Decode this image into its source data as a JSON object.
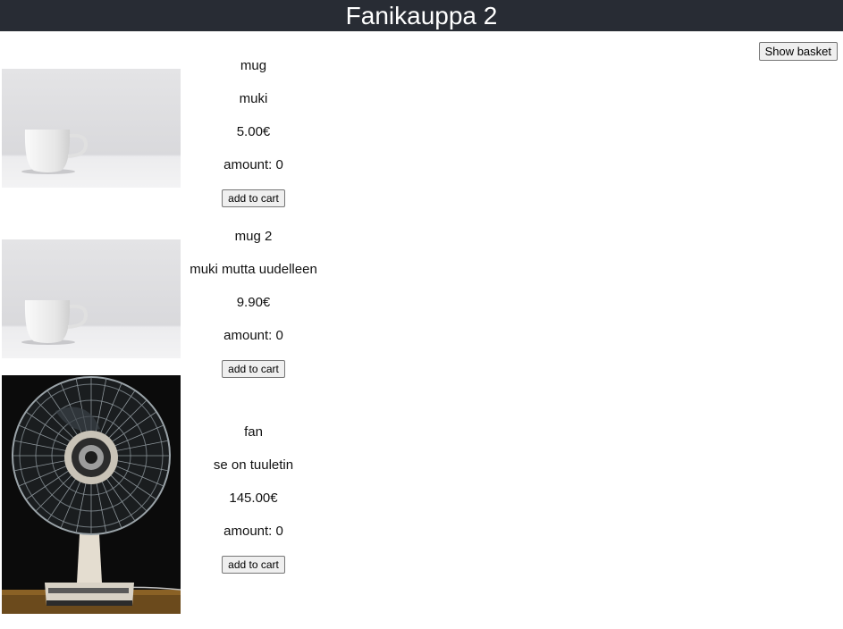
{
  "header": {
    "title": "Fanikauppa 2"
  },
  "basket_button": "Show basket",
  "products": [
    {
      "name": "mug",
      "description": "muki",
      "price": "5.00€",
      "amount": "amount: 0",
      "add_label": "add to cart",
      "image": "white-mug-photo"
    },
    {
      "name": "mug 2",
      "description": "muki mutta uudelleen",
      "price": "9.90€",
      "amount": "amount: 0",
      "add_label": "add to cart",
      "image": "white-mug-photo"
    },
    {
      "name": "fan",
      "description": "se on tuuletin",
      "price": "145.00€",
      "amount": "amount: 0",
      "add_label": "add to cart",
      "image": "desk-fan-photo"
    }
  ]
}
